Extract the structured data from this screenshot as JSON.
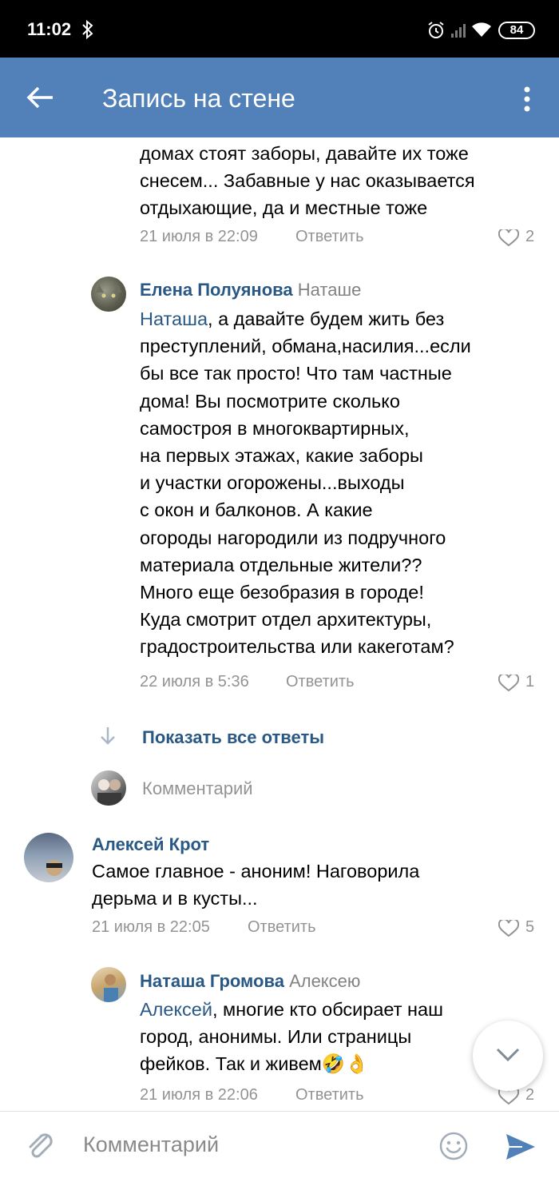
{
  "status_bar": {
    "time": "11:02",
    "battery": "84"
  },
  "header": {
    "title": "Запись на стене"
  },
  "comments": [
    {
      "text_lines": [
        "домах стоят заборы, давайте их тоже",
        "снесем... Забавные у нас оказывается",
        "отдыхающие, да и местные тоже"
      ],
      "date": "21 июля в 22:09",
      "reply_label": "Ответить",
      "likes": "2"
    },
    {
      "author": "Елена Полуянова",
      "reply_to": "Наташе",
      "mention": "Наташа",
      "first_line_rest": ", а давайте будем жить без",
      "text_lines": [
        "преступлений, обмана,насилия...если",
        "бы все так просто! Что там частные",
        "дома! Вы посмотрите сколько",
        "самостроя в многоквартирных,",
        "на первых этажах, какие заборы",
        "и участки огорожены...выходы",
        "с окон и балконов. А  какие",
        "огороды нагородили из подручного",
        "материала отдельные жители??",
        "Много еще безобразия в городе!",
        "Куда смотрит отдел архитектуры,",
        "градостроительства или какеготам?"
      ],
      "date": "22 июля в 5:36",
      "reply_label": "Ответить",
      "likes": "1"
    },
    {
      "author": "Алексей Крот",
      "text_lines": [
        "Самое главное - аноним! Наговорила",
        "дерьма и в кусты..."
      ],
      "date": "21 июля в 22:05",
      "reply_label": "Ответить",
      "likes": "5"
    },
    {
      "author": "Наташа Громова",
      "reply_to": "Алексею",
      "mention": "Алексей",
      "first_line_rest": ", многие кто обсирает наш",
      "text_lines": [
        "город, анонимы.  Или страницы",
        "фейков.  Так и живем🤣👌"
      ],
      "date": "21 июля в 22:06",
      "reply_label": "Ответить",
      "likes": "2"
    }
  ],
  "show_all_replies": "Показать все ответы",
  "reply_placeholder": "Комментарий",
  "composer": {
    "placeholder": "Комментарий"
  },
  "colors": {
    "header": "#5181b8",
    "link": "#2a5885",
    "meta": "#939393",
    "send": "#5181b8"
  },
  "icons": [
    "back-arrow-icon",
    "more-vert-icon",
    "heart-icon",
    "down-arrow-icon",
    "chevron-down-icon",
    "attach-icon",
    "emoji-icon",
    "send-icon"
  ]
}
